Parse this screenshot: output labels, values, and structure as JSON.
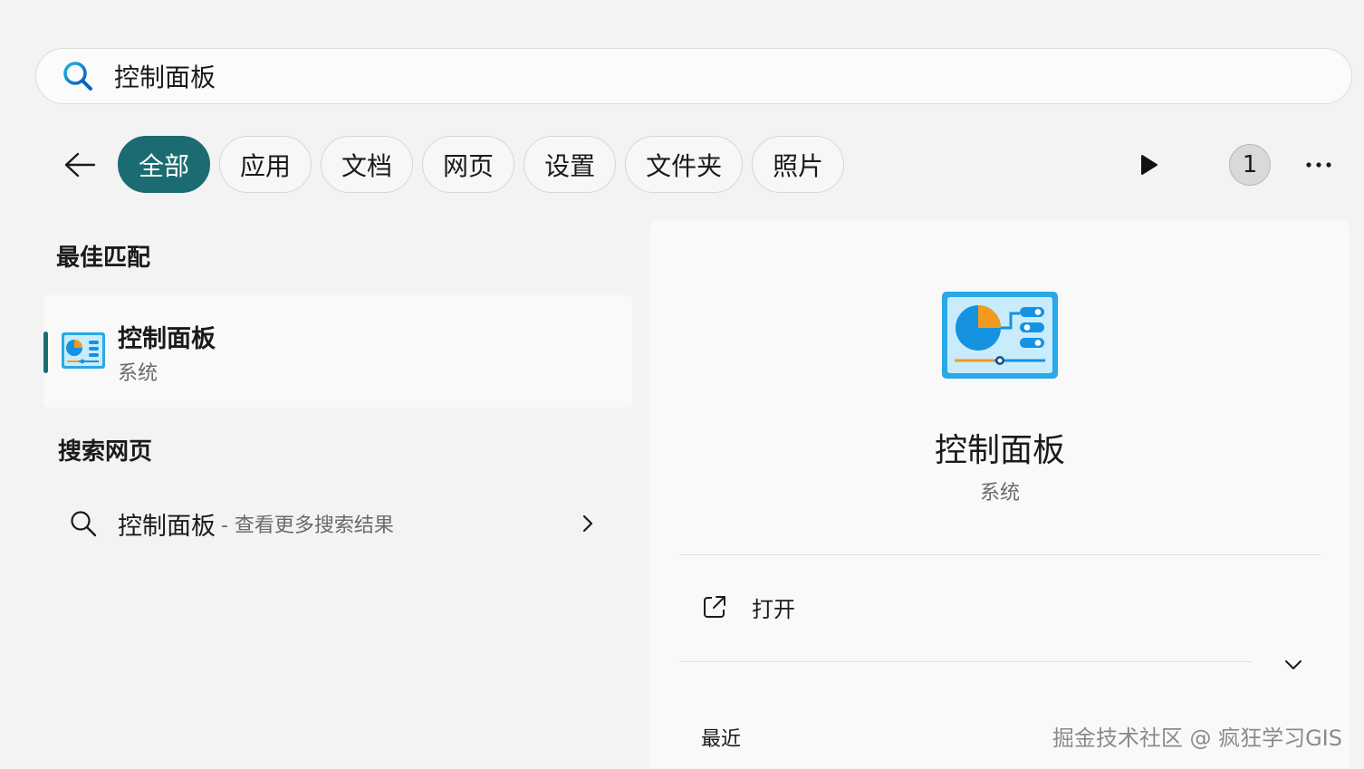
{
  "search": {
    "value": "控制面板"
  },
  "filters": {
    "chips": [
      "全部",
      "应用",
      "文档",
      "网页",
      "设置",
      "文件夹",
      "照片"
    ],
    "active_index": 0,
    "badge_count": "1"
  },
  "best_match": {
    "section_title": "最佳匹配",
    "name": "控制面板",
    "category": "系统"
  },
  "web_search": {
    "section_title": "搜索网页",
    "query": "控制面板",
    "hint": "- 查看更多搜索结果"
  },
  "detail": {
    "title": "控制面板",
    "category": "系统",
    "open_label": "打开",
    "recent_label": "最近"
  },
  "watermark": "掘金技术社区 @ 疯狂学习GIS",
  "colors": {
    "accent": "#1b6c72"
  },
  "icons": {
    "search": "search-icon",
    "back": "arrow-left-icon",
    "play": "play-icon",
    "more": "more-horizontal-icon",
    "app": "control-panel-icon",
    "open": "open-external-icon",
    "chevron_right": "chevron-right-icon",
    "chevron_down": "chevron-down-icon"
  }
}
